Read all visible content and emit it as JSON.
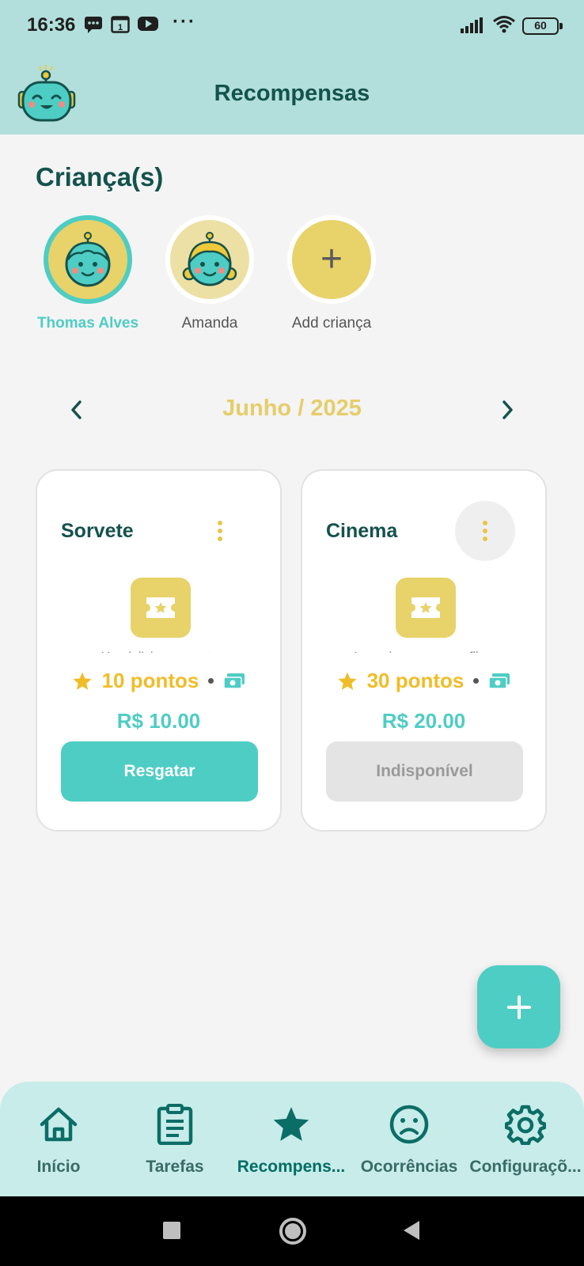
{
  "status_bar": {
    "time": "16:36",
    "battery": "60"
  },
  "header": {
    "title": "Recompensas"
  },
  "children_section": {
    "title": "Criança(s)",
    "children": [
      {
        "name": "Thomas Alves",
        "selected": true
      },
      {
        "name": "Amanda",
        "selected": false
      }
    ],
    "add_label": "Add criança"
  },
  "month_nav": {
    "label": "Junho / 2025"
  },
  "rewards": [
    {
      "title": "Sorvete",
      "description": "Um delicioso sorvete",
      "points": "10 pontos",
      "price": "R$ 10.00",
      "button": "Resgatar",
      "available": true
    },
    {
      "title": "Cinema",
      "description": "Ir ao cinema ver um filme",
      "points": "30 pontos",
      "price": "R$ 20.00",
      "button": "Indisponível",
      "available": false
    }
  ],
  "bottom_nav": {
    "items": [
      {
        "label": "Início",
        "icon": "home-icon"
      },
      {
        "label": "Tarefas",
        "icon": "clipboard-icon"
      },
      {
        "label": "Recompens...",
        "icon": "star-icon",
        "active": true
      },
      {
        "label": "Ocorrências",
        "icon": "sad-face-icon"
      },
      {
        "label": "Configuraçõ...",
        "icon": "gear-icon"
      }
    ]
  },
  "colors": {
    "accent": "#4ecdc4",
    "dark_teal": "#14524d",
    "header_bg": "#b2dfdb",
    "gold": "#e8d26a",
    "points": "#f0bd28"
  }
}
